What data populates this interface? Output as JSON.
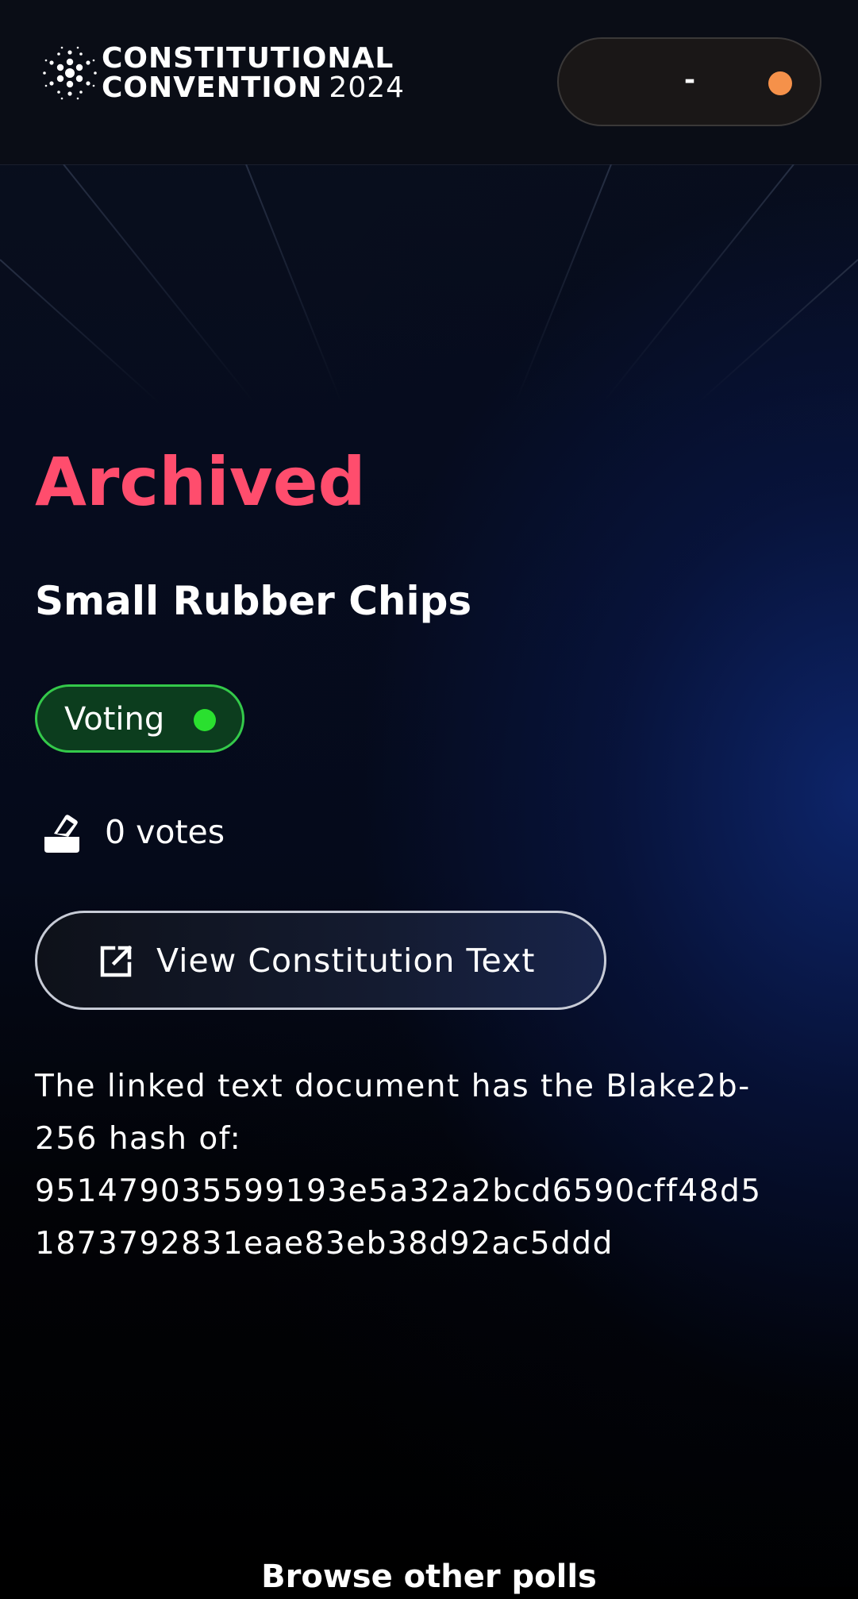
{
  "header": {
    "logo_line1": "CONSTITUTIONAL",
    "logo_line2": "CONVENTION",
    "logo_year": "2024",
    "logo_icon": "cardano-icon",
    "wallet": {
      "label": "-",
      "status_dot_color": "#f5914a"
    }
  },
  "poll": {
    "status_title": "Archived",
    "status_title_color": "#ff4d6d",
    "name": "Small Rubber Chips",
    "phase_badge": {
      "label": "Voting",
      "dot_color": "#2ae02f",
      "border_color": "#34c94a"
    },
    "votes": {
      "icon": "ballot-box-icon",
      "label": "0 votes"
    },
    "view_button": {
      "icon": "external-link-icon",
      "label": "View Constitution Text"
    },
    "hash_lines": [
      "The linked text document has the Blake2b-",
      "256 hash of:",
      "951479035599193e5a32a2bcd6590cff48d5",
      "1873792831eae83eb38d92ac5ddd"
    ]
  },
  "footer": {
    "browse_label": "Browse other polls"
  }
}
